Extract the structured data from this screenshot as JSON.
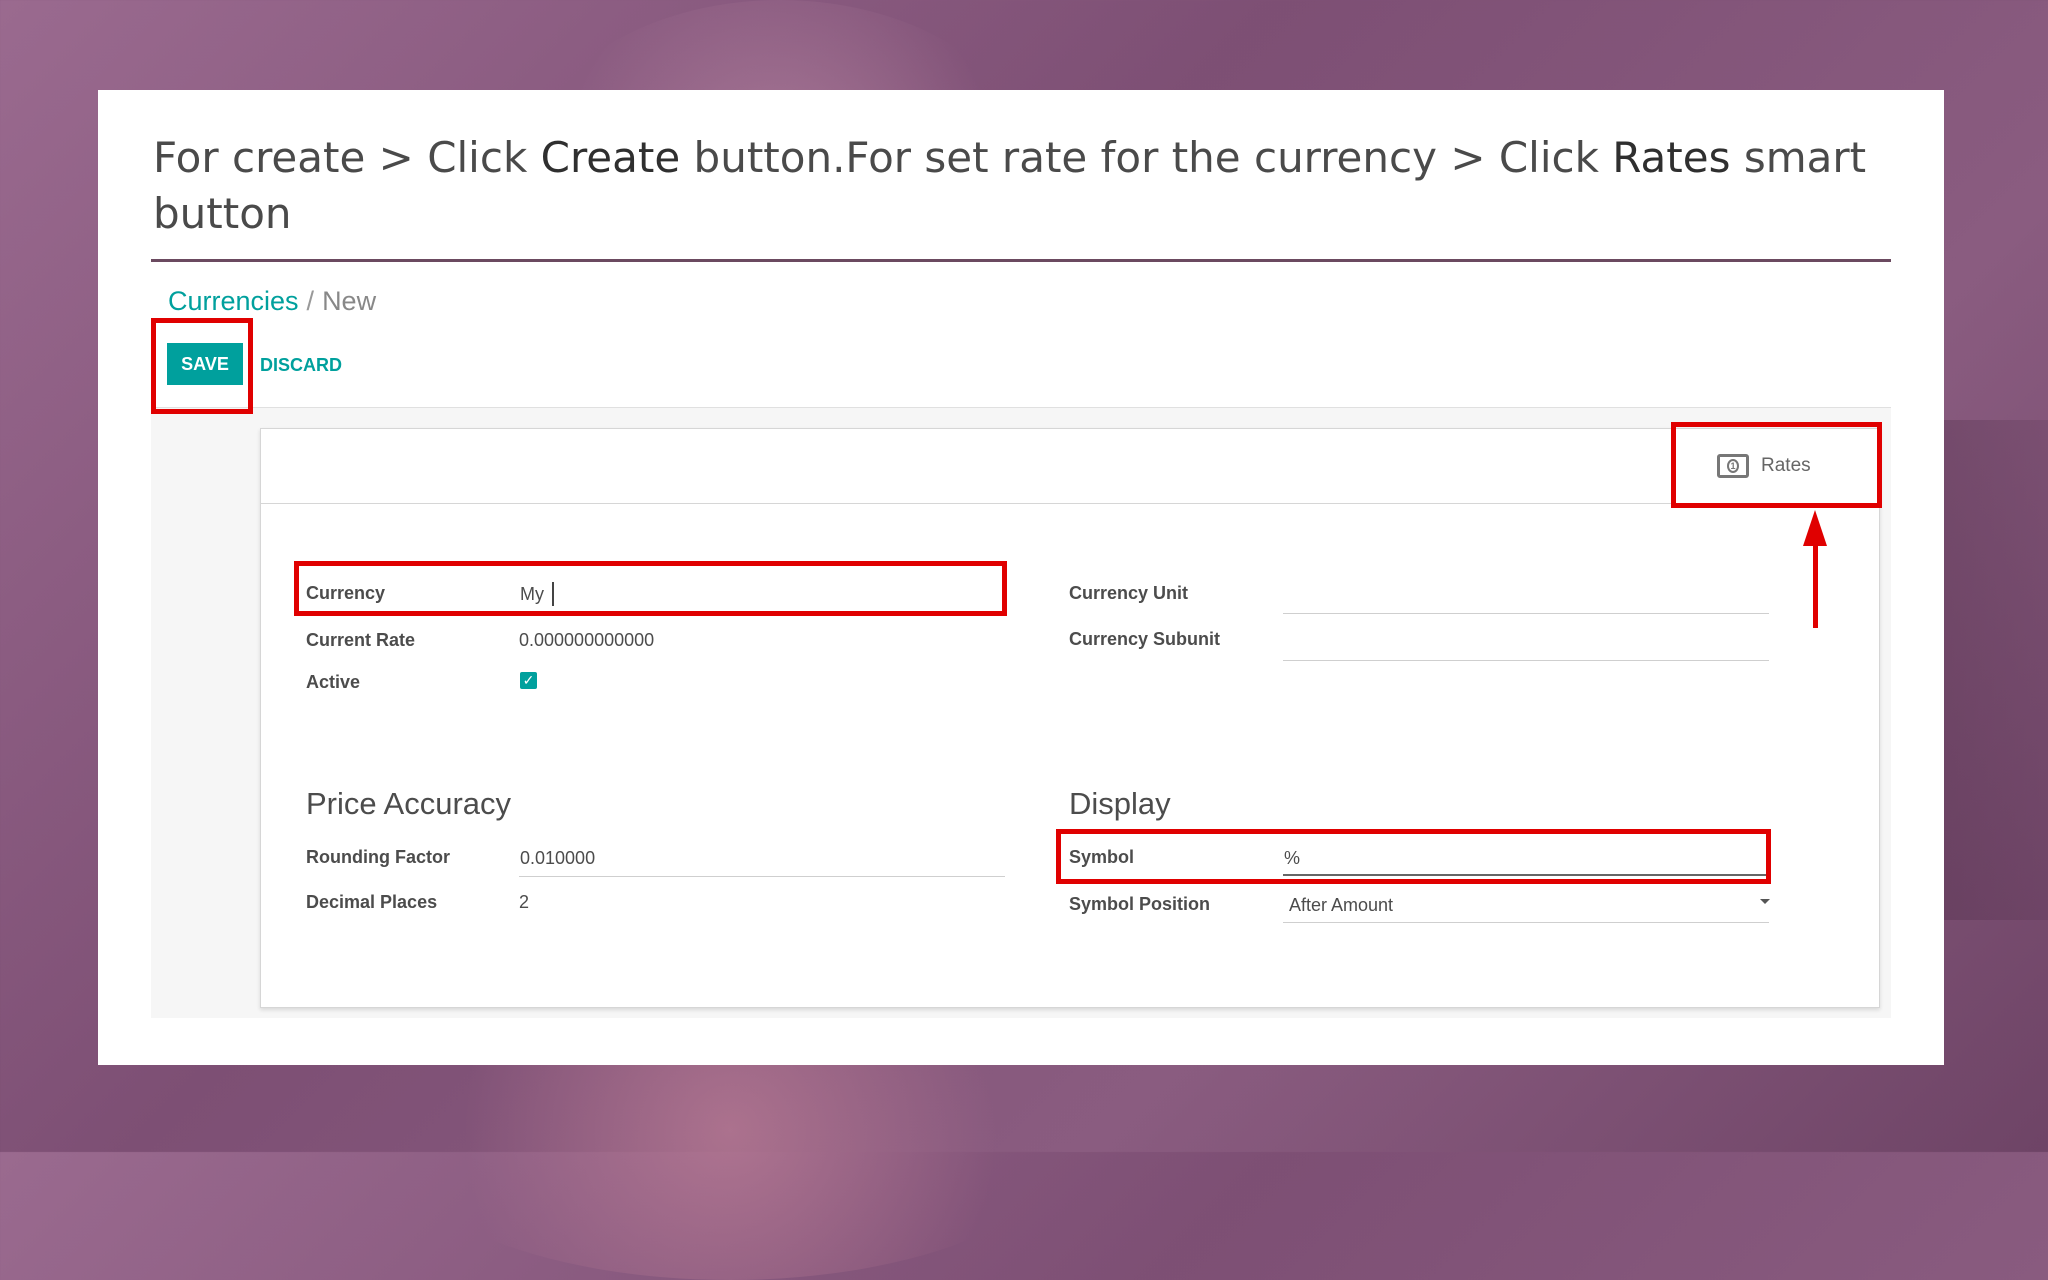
{
  "instruction": {
    "part1": "For create > Click ",
    "bold1": "Create",
    "part2": " button.For set rate for the currency > Click ",
    "bold2": "Rates",
    "part3": " smart button"
  },
  "breadcrumb": {
    "parent": "Currencies",
    "separator": "/",
    "current": "New"
  },
  "toolbar": {
    "save_label": "SAVE",
    "discard_label": "DISCARD"
  },
  "smart_button": {
    "label": "Rates",
    "icon": "money-icon"
  },
  "form": {
    "currency": {
      "label": "Currency",
      "value": "My"
    },
    "current_rate": {
      "label": "Current Rate",
      "value": "0.000000000000"
    },
    "active": {
      "label": "Active",
      "checked": true
    },
    "currency_unit": {
      "label": "Currency Unit",
      "value": ""
    },
    "currency_subunit": {
      "label": "Currency Subunit",
      "value": ""
    },
    "price_accuracy": {
      "title": "Price Accuracy",
      "rounding_factor": {
        "label": "Rounding Factor",
        "value": "0.010000"
      },
      "decimal_places": {
        "label": "Decimal Places",
        "value": "2"
      }
    },
    "display": {
      "title": "Display",
      "symbol": {
        "label": "Symbol",
        "value": "%"
      },
      "symbol_position": {
        "label": "Symbol Position",
        "value": "After Amount"
      }
    }
  },
  "colors": {
    "accent": "#00a09d",
    "highlight": "#e00000"
  }
}
